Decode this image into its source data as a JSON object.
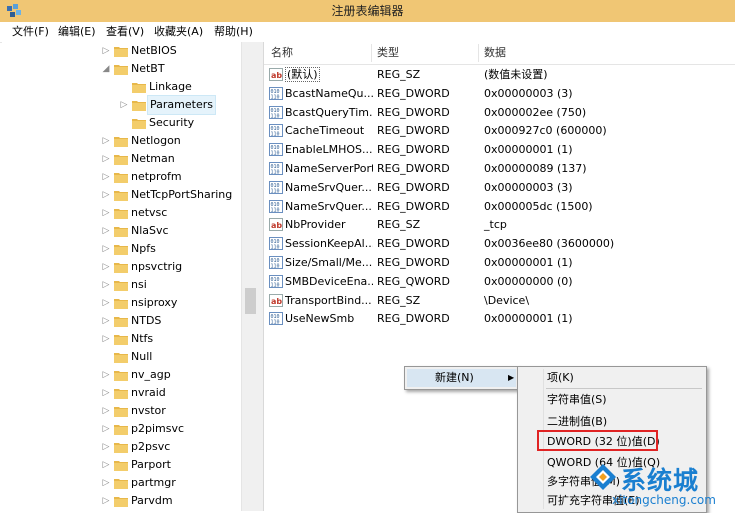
{
  "window": {
    "title": "注册表编辑器"
  },
  "menu": [
    "文件(F)",
    "编辑(E)",
    "查看(V)",
    "收藏夹(A)",
    "帮助(H)"
  ],
  "tree": [
    {
      "label": "NetBIOS",
      "level": 0,
      "expander": "closed"
    },
    {
      "label": "NetBT",
      "level": 0,
      "expander": "open"
    },
    {
      "label": "Linkage",
      "level": 1,
      "expander": "none"
    },
    {
      "label": "Parameters",
      "level": 1,
      "expander": "closed",
      "selected": true
    },
    {
      "label": "Security",
      "level": 1,
      "expander": "none"
    },
    {
      "label": "Netlogon",
      "level": 0,
      "expander": "closed"
    },
    {
      "label": "Netman",
      "level": 0,
      "expander": "closed"
    },
    {
      "label": "netprofm",
      "level": 0,
      "expander": "closed"
    },
    {
      "label": "NetTcpPortSharing",
      "level": 0,
      "expander": "closed"
    },
    {
      "label": "netvsc",
      "level": 0,
      "expander": "closed"
    },
    {
      "label": "NlaSvc",
      "level": 0,
      "expander": "closed"
    },
    {
      "label": "Npfs",
      "level": 0,
      "expander": "closed"
    },
    {
      "label": "npsvctrig",
      "level": 0,
      "expander": "closed"
    },
    {
      "label": "nsi",
      "level": 0,
      "expander": "closed"
    },
    {
      "label": "nsiproxy",
      "level": 0,
      "expander": "closed"
    },
    {
      "label": "NTDS",
      "level": 0,
      "expander": "closed"
    },
    {
      "label": "Ntfs",
      "level": 0,
      "expander": "closed"
    },
    {
      "label": "Null",
      "level": 0,
      "expander": "none"
    },
    {
      "label": "nv_agp",
      "level": 0,
      "expander": "closed"
    },
    {
      "label": "nvraid",
      "level": 0,
      "expander": "closed"
    },
    {
      "label": "nvstor",
      "level": 0,
      "expander": "closed"
    },
    {
      "label": "p2pimsvc",
      "level": 0,
      "expander": "closed"
    },
    {
      "label": "p2psvc",
      "level": 0,
      "expander": "closed"
    },
    {
      "label": "Parport",
      "level": 0,
      "expander": "closed"
    },
    {
      "label": "partmgr",
      "level": 0,
      "expander": "closed"
    },
    {
      "label": "Parvdm",
      "level": 0,
      "expander": "closed"
    }
  ],
  "columns": {
    "name": "名称",
    "type": "类型",
    "data": "数据"
  },
  "values": [
    {
      "name": "(默认)",
      "type": "REG_SZ",
      "data": "(数值未设置)",
      "icon": "string-value-icon",
      "default": true
    },
    {
      "name": "BcastNameQu...",
      "type": "REG_DWORD",
      "data": "0x00000003 (3)",
      "icon": "dword-value-icon"
    },
    {
      "name": "BcastQueryTim...",
      "type": "REG_DWORD",
      "data": "0x000002ee (750)",
      "icon": "dword-value-icon"
    },
    {
      "name": "CacheTimeout",
      "type": "REG_DWORD",
      "data": "0x000927c0 (600000)",
      "icon": "dword-value-icon"
    },
    {
      "name": "EnableLMHOS...",
      "type": "REG_DWORD",
      "data": "0x00000001 (1)",
      "icon": "dword-value-icon"
    },
    {
      "name": "NameServerPort",
      "type": "REG_DWORD",
      "data": "0x00000089 (137)",
      "icon": "dword-value-icon"
    },
    {
      "name": "NameSrvQuer...",
      "type": "REG_DWORD",
      "data": "0x00000003 (3)",
      "icon": "dword-value-icon"
    },
    {
      "name": "NameSrvQuer...",
      "type": "REG_DWORD",
      "data": "0x000005dc (1500)",
      "icon": "dword-value-icon"
    },
    {
      "name": "NbProvider",
      "type": "REG_SZ",
      "data": "_tcp",
      "icon": "string-value-icon"
    },
    {
      "name": "SessionKeepAl...",
      "type": "REG_DWORD",
      "data": "0x0036ee80 (3600000)",
      "icon": "dword-value-icon"
    },
    {
      "name": "Size/Small/Me...",
      "type": "REG_DWORD",
      "data": "0x00000001 (1)",
      "icon": "dword-value-icon"
    },
    {
      "name": "SMBDeviceEna...",
      "type": "REG_QWORD",
      "data": "0x00000000 (0)",
      "icon": "dword-value-icon"
    },
    {
      "name": "TransportBind...",
      "type": "REG_SZ",
      "data": "\\Device\\",
      "icon": "string-value-icon"
    },
    {
      "name": "UseNewSmb",
      "type": "REG_DWORD",
      "data": "0x00000001 (1)",
      "icon": "dword-value-icon"
    }
  ],
  "context_menu": {
    "new_label": "新建(N)"
  },
  "submenu": [
    {
      "label": "项(K)"
    },
    {
      "sep": true
    },
    {
      "label": "字符串值(S)"
    },
    {
      "label": "二进制值(B)"
    },
    {
      "label": "DWORD (32 位)值(D)",
      "highlighted": true
    },
    {
      "label": "QWORD (64 位)值(Q)"
    },
    {
      "label": "多字符串值(M)"
    },
    {
      "label": "可扩充字符串值(E)"
    }
  ],
  "watermark": {
    "text": "系统城",
    "url": "xitongcheng.com"
  },
  "colors": {
    "titlebar": "#f0c674",
    "highlight_border": "#e02424",
    "folder": "#e8b84a",
    "watermark": "#1a7fd0"
  }
}
